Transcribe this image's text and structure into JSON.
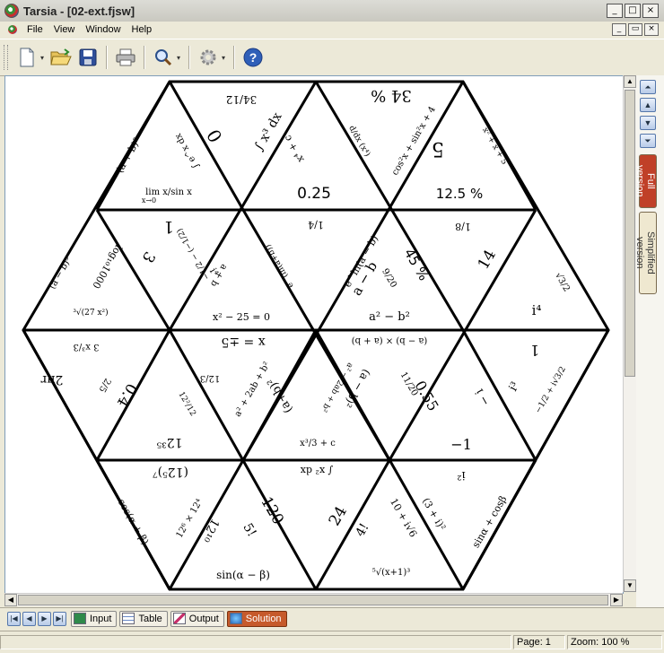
{
  "window": {
    "title": "Tarsia - [02-ext.fjsw]"
  },
  "menu": {
    "items": [
      "File",
      "View",
      "Window",
      "Help"
    ]
  },
  "window_controls": {
    "minimize": "_",
    "maximize": "□",
    "close": "×",
    "restore": "▭"
  },
  "toolbar": {
    "drop": "▾"
  },
  "sidebar": {
    "full_version": "Full version",
    "simplified_version": "Simplified version"
  },
  "nav": {
    "up_end": "⏶",
    "up": "▲",
    "down": "▼",
    "down_end": "⏷",
    "first": "|◀",
    "prev": "◀",
    "next": "▶",
    "last": "▶|"
  },
  "tabs": [
    {
      "label": "Input",
      "active": false
    },
    {
      "label": "Table",
      "active": false
    },
    {
      "label": "Output",
      "active": false
    },
    {
      "label": "Solution",
      "active": true
    }
  ],
  "status": {
    "page": "Page: 1",
    "zoom": "Zoom: 100 %"
  },
  "puzzle": {
    "t1": "lim x/sin x",
    "t1b": "x→0",
    "t1c": "∫ e^x dx",
    "t1d": "(a + b)³",
    "t2": "34/12",
    "t2b": "0",
    "t2c": "∫ x³ dx",
    "t2d": "x⁴ + c",
    "t3": "0.25",
    "t3b": "34 %",
    "t3c": "cos²x + sin²x + 4",
    "t3d": "d/dx (x⁴)",
    "t4": "12.5 %",
    "t4b": "5",
    "t4c": "x² + x + 5",
    "t5": "3",
    "t5b": "log₁₀1000",
    "t5c": "³√(27 x²)",
    "t5d": "(a − b)³",
    "t6": "1",
    "t6b": "i⁴",
    "t6c": "−1/2 − (−1/2)",
    "t7": "x² − 25 = 0",
    "t7b": "e^(ln(a+b))",
    "t7c": "a + b",
    "t8": "1/4",
    "t8b": "e^ln(a − b)",
    "t9": "a² − b²",
    "t9b": "a − b",
    "t9c": "45 %",
    "t9d": "9/20",
    "t10": "1/8",
    "t10b": "14",
    "t11": "i⁴",
    "t11b": "√3/2",
    "t12": "2πr",
    "t12b": "3 x³/3",
    "t13": "x = ±5",
    "t13b": "0.4",
    "t13c": "2/5",
    "t14": "12³⁵",
    "t14b": "12/3",
    "t14c": "12²/12",
    "t15": "(a+b)²",
    "t15b": "a² + 2ab + b²",
    "t16": "(a − b) × (a + b)",
    "t16b": "(a − b)²",
    "t16c": "a² − 2ab + b²",
    "t17": "x³/3 + c",
    "t18": "0.55",
    "t18b": "11/20",
    "t19": "1",
    "t19b": "− i",
    "t19c": "−1/2 + i√3/2",
    "t20": "−1",
    "t20b": "i³",
    "t21": "(12⁵)⁷",
    "t21b": "cos(α + β)",
    "t22": "12⁶ × 12⁴",
    "t22b": "12¹⁰",
    "t23": "∫ x² dx",
    "t24": "120",
    "t24b": "5!",
    "t25": "sin(α − β)",
    "t26": "24",
    "t26b": "4!",
    "t27": "10 + i√6",
    "t28": "⁵√(x+1)³",
    "t29": "i²",
    "t29b": "(3 + i)²",
    "t30": "sinα + cosβ"
  }
}
